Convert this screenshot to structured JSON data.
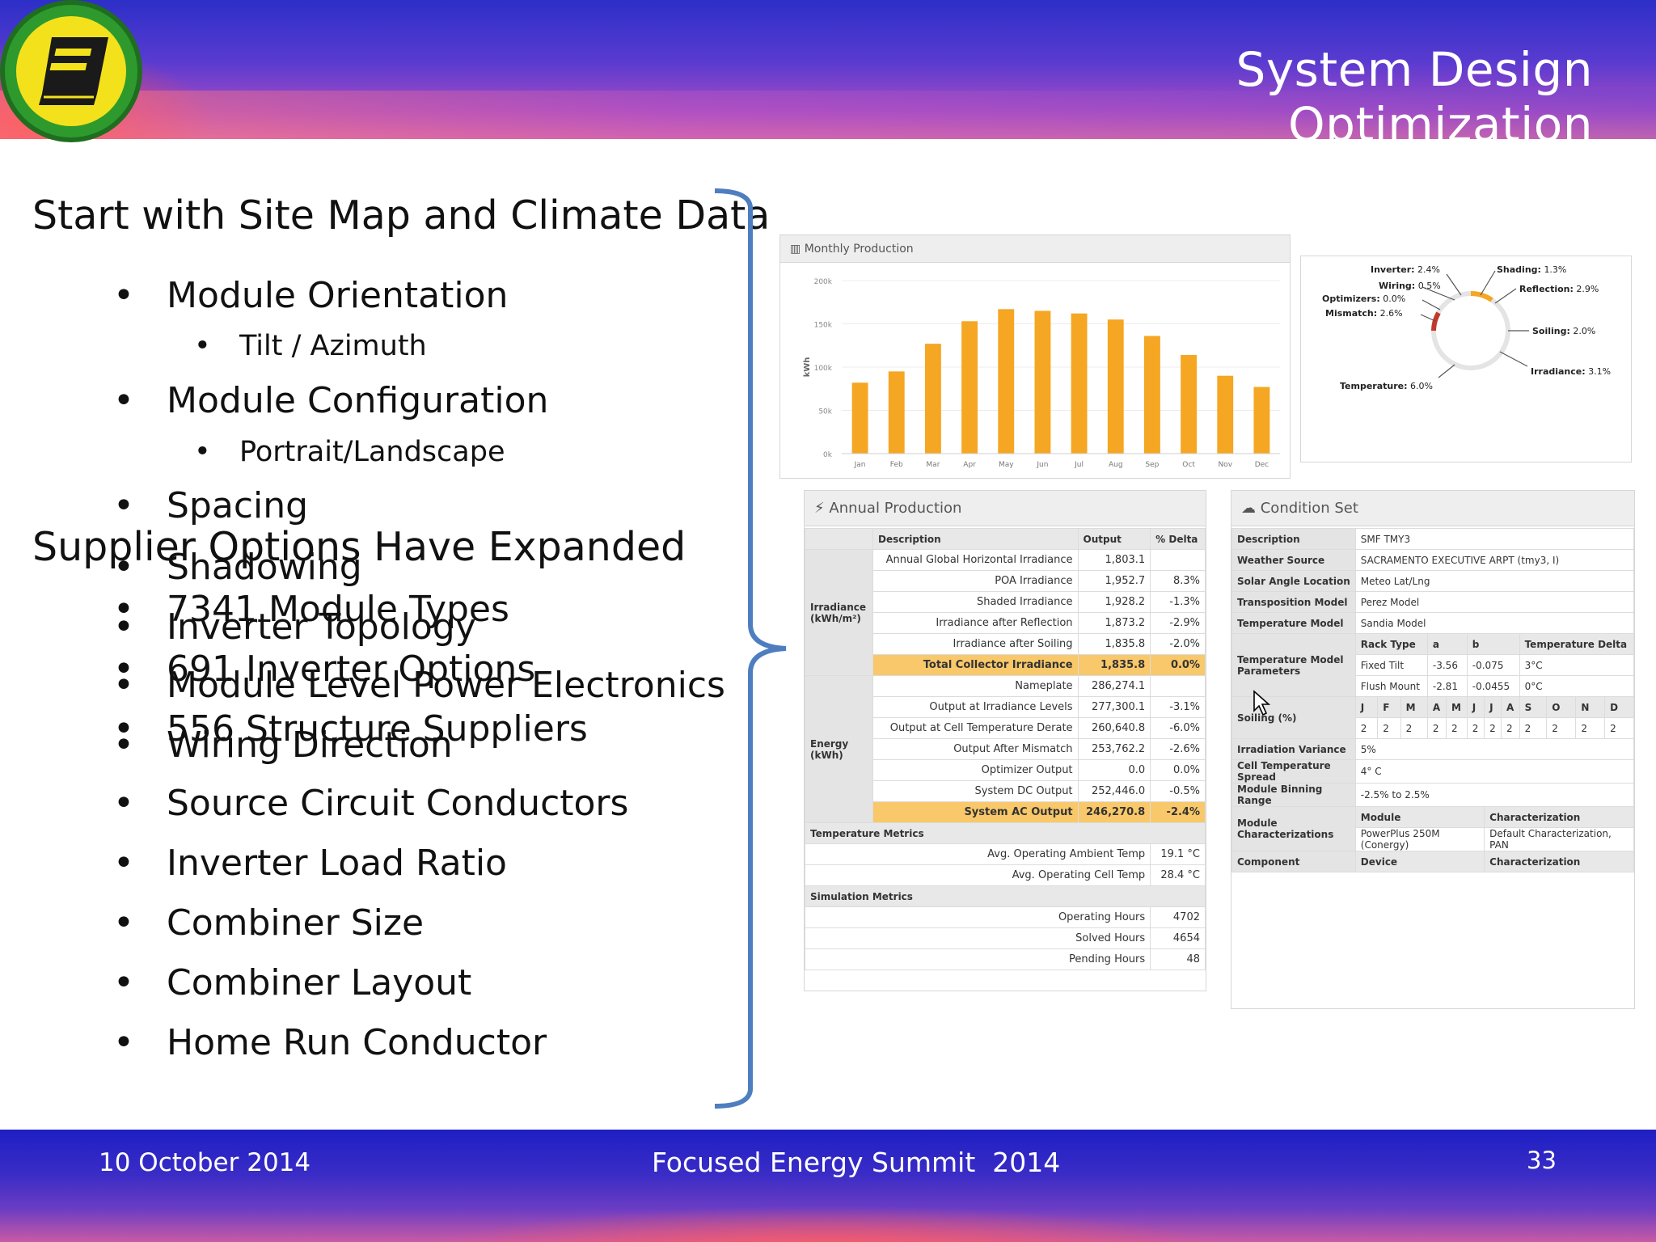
{
  "slide": {
    "title": "System Design Optimization",
    "heading_1": "Start with Site Map and Climate Data",
    "heading_2": "Supplier Options Have Expanded"
  },
  "bullets_site": [
    {
      "text": "Module Orientation",
      "sub": "Tilt / Azimuth"
    },
    {
      "text": "Module Configuration",
      "sub": "Portrait/Landscape"
    },
    {
      "text": "Spacing"
    },
    {
      "text": "Shadowing"
    },
    {
      "text": "Inverter Topology"
    },
    {
      "text": "Module Level Power Electronics"
    },
    {
      "text": "Wiring Direction"
    },
    {
      "text": "Source Circuit Conductors"
    },
    {
      "text": "Inverter Load Ratio"
    },
    {
      "text": "Combiner Size"
    },
    {
      "text": "Combiner Layout"
    },
    {
      "text": "Home Run Conductor"
    }
  ],
  "bullets_supplier": [
    "7341 Module Types",
    "691 Inverter Options",
    "556 Structure Suppliers"
  ],
  "bullet_glyph": "•",
  "footer": {
    "date": "10 October 2014",
    "event": "Focused Energy Summit  2014",
    "page": "33"
  },
  "screenshot": {
    "monthly_production": {
      "title": "Monthly Production",
      "chart_data": {
        "type": "bar",
        "ylabel": "kWh",
        "categories": [
          "Jan",
          "Feb",
          "Mar",
          "Apr",
          "May",
          "Jun",
          "Jul",
          "Aug",
          "Sep",
          "Oct",
          "Nov",
          "Dec"
        ],
        "values": [
          82,
          95,
          127,
          153,
          167,
          165,
          162,
          155,
          136,
          114,
          90,
          77
        ],
        "y_ticks": [
          "0k",
          "50k",
          "100k",
          "150k",
          "200k"
        ],
        "ylim": [
          0,
          200
        ],
        "color": "#f5a623"
      }
    },
    "losses": {
      "Inverter": "2.4%",
      "Wiring": "0.5%",
      "Optimizers": "0.0%",
      "Mismatch": "2.6%",
      "Temperature": "6.0%",
      "Shading": "1.3%",
      "Reflection": "2.9%",
      "Soiling": "2.0%",
      "Irradiance": "3.1%"
    },
    "annual_production": {
      "title": "Annual Production",
      "headers": [
        "Description",
        "Output",
        "% Delta"
      ],
      "irradiance_group": "Irradiance (kWh/m²)",
      "energy_group": "Energy (kWh)",
      "rows_irradiance": [
        [
          "Annual Global Horizontal Irradiance",
          "1,803.1",
          ""
        ],
        [
          "POA Irradiance",
          "1,952.7",
          "8.3%"
        ],
        [
          "Shaded Irradiance",
          "1,928.2",
          "-1.3%"
        ],
        [
          "Irradiance after Reflection",
          "1,873.2",
          "-2.9%"
        ],
        [
          "Irradiance after Soiling",
          "1,835.8",
          "-2.0%"
        ],
        [
          "Total Collector Irradiance",
          "1,835.8",
          "0.0%"
        ]
      ],
      "rows_energy": [
        [
          "Nameplate",
          "286,274.1",
          ""
        ],
        [
          "Output at Irradiance Levels",
          "277,300.1",
          "-3.1%"
        ],
        [
          "Output at Cell Temperature Derate",
          "260,640.8",
          "-6.0%"
        ],
        [
          "Output After Mismatch",
          "253,762.2",
          "-2.6%"
        ],
        [
          "Optimizer Output",
          "0.0",
          "0.0%"
        ],
        [
          "System DC Output",
          "252,446.0",
          "-0.5%"
        ],
        [
          "System AC Output",
          "246,270.8",
          "-2.4%"
        ]
      ],
      "temp_title": "Temperature Metrics",
      "rows_temp": [
        [
          "Avg. Operating Ambient Temp",
          "19.1 °C"
        ],
        [
          "Avg. Operating Cell Temp",
          "28.4 °C"
        ]
      ],
      "sim_title": "Simulation Metrics",
      "rows_sim": [
        [
          "Operating Hours",
          "4702"
        ],
        [
          "Solved Hours",
          "4654"
        ],
        [
          "Pending Hours",
          "48"
        ]
      ]
    },
    "condition_set": {
      "title": "Condition Set",
      "rows": [
        [
          "Description",
          "SMF TMY3"
        ],
        [
          "Weather Source",
          "SACRAMENTO EXECUTIVE ARPT (tmy3, I)"
        ],
        [
          "Solar Angle Location",
          "Meteo Lat/Lng"
        ],
        [
          "Transposition Model",
          "Perez Model"
        ],
        [
          "Temperature Model",
          "Sandia Model"
        ]
      ],
      "temp_params_label": "Temperature Model Parameters",
      "temp_params_headers": [
        "Rack Type",
        "a",
        "b",
        "Temperature Delta"
      ],
      "temp_params_rows": [
        [
          "Fixed Tilt",
          "-3.56",
          "-0.075",
          "3°C"
        ],
        [
          "Flush Mount",
          "-2.81",
          "-0.0455",
          "0°C"
        ]
      ],
      "soiling_label": "Soiling (%)",
      "months": [
        "J",
        "F",
        "M",
        "A",
        "M",
        "J",
        "J",
        "A",
        "S",
        "O",
        "N",
        "D"
      ],
      "soiling_values": [
        "2",
        "2",
        "2",
        "2",
        "2",
        "2",
        "2",
        "2",
        "2",
        "2",
        "2",
        "2"
      ],
      "irr_var_label": "Irradiation Variance",
      "irr_var": "5%",
      "cell_temp_label": "Cell Temperature Spread",
      "cell_temp": "4° C",
      "binning_label": "Module Binning Range",
      "binning": "-2.5% to 2.5%",
      "modchar_label": "Module Characterizations",
      "modchar_headers": [
        "Module",
        "Characterization"
      ],
      "modchar_row": [
        "PowerPlus 250M (Conergy)",
        "Default Characterization, PAN"
      ],
      "component_label": "Component",
      "component_headers": [
        "Device",
        "Characterization"
      ]
    }
  }
}
